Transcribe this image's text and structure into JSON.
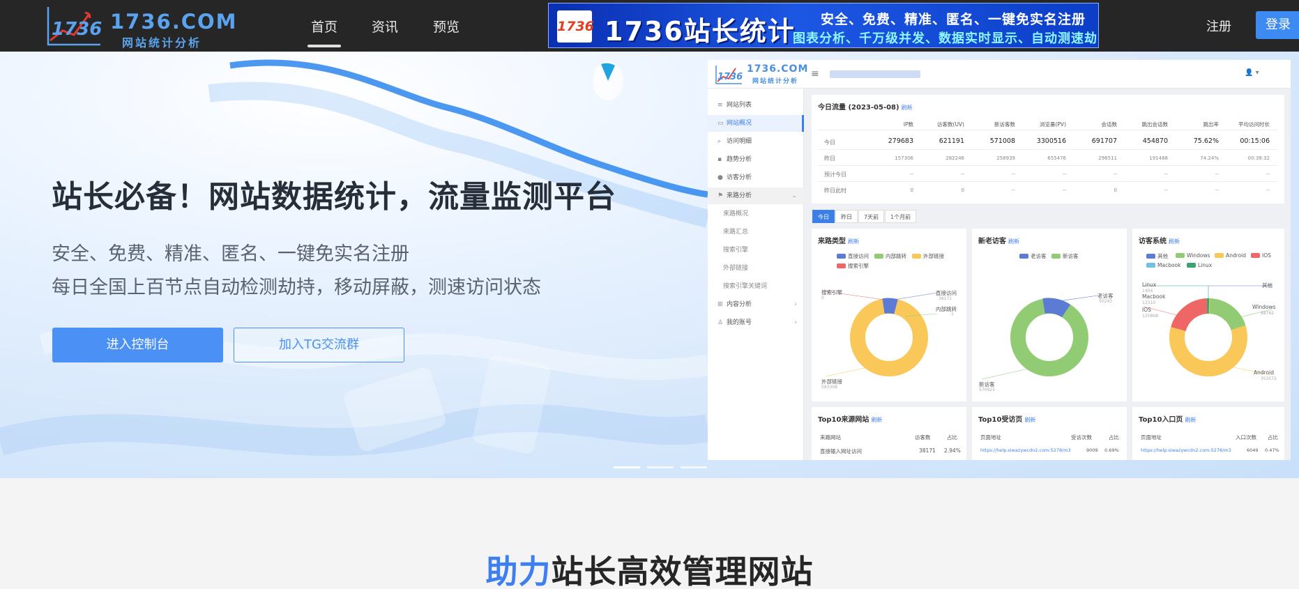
{
  "brand": {
    "name": "1736.COM",
    "subtitle": "网站统计分析",
    "mark_text": "1736"
  },
  "nav": {
    "items": [
      "首页",
      "资讯",
      "预览"
    ],
    "active_index": 0
  },
  "ad_banner": {
    "logo_text": "1736",
    "title": "1736站长统计",
    "line1": "安全、免费、精准、匿名、一键免实名注册",
    "line2": "图表分析、千万级并发、数据实时显示、自动测速劫持检测"
  },
  "auth": {
    "register": "注册",
    "login": "登录"
  },
  "hero": {
    "headline": "站长必备！网站数据统计，流量监测平台",
    "tagline1": "安全、免费、精准、匿名、一键免实名注册",
    "tagline2": "每日全国上百节点自动检测劫持，移动屏蔽，测速访问状态",
    "btn_console": "进入控制台",
    "btn_tg": "加入TG交流群",
    "slide_count": 3,
    "active_slide": 0
  },
  "dashboard": {
    "logo": {
      "mark": "1736",
      "name": "1736.COM",
      "sub": "网站统计分析"
    },
    "menu": [
      {
        "label": "网站列表",
        "icon": "list-icon"
      },
      {
        "label": "网站概况",
        "icon": "monitor-icon",
        "selected": true
      },
      {
        "label": "访问明细",
        "icon": "search-icon"
      },
      {
        "label": "趋势分析",
        "icon": "chart-icon"
      },
      {
        "label": "访客分析",
        "icon": "user-icon"
      },
      {
        "label": "来路分析",
        "icon": "flag-icon",
        "group": true
      },
      {
        "label": "来路概况",
        "sub": true
      },
      {
        "label": "来路汇总",
        "sub": true
      },
      {
        "label": "搜索引擎",
        "sub": true
      },
      {
        "label": "外部链接",
        "sub": true
      },
      {
        "label": "搜索引擎关键词",
        "sub": true
      },
      {
        "label": "内容分析",
        "icon": "grid-icon",
        "group": true
      },
      {
        "label": "我的账号",
        "icon": "person-icon",
        "group": true
      }
    ],
    "traffic": {
      "title": "今日流量 (2023-05-08)",
      "refresh": "刷新",
      "columns": [
        "IP数",
        "访客数(UV)",
        "新访客数",
        "浏览量(PV)",
        "会话数",
        "跳出会话数",
        "跳出率",
        "平均访问时长"
      ],
      "rows": [
        {
          "label": "今日",
          "values": [
            "279683",
            "621191",
            "571008",
            "3300516",
            "691707",
            "454870",
            "75.62%",
            "00:15:06"
          ]
        },
        {
          "label": "昨日",
          "values": [
            "157306",
            "282246",
            "258939",
            "655476",
            "296511",
            "191488",
            "74.24%",
            "00:38:32"
          ]
        },
        {
          "label": "预计今日",
          "values": [
            "--",
            "--",
            "--",
            "--",
            "--",
            "--",
            "--",
            "--"
          ]
        },
        {
          "label": "昨日此时",
          "values": [
            "0",
            "0",
            "--",
            "--",
            "0",
            "--",
            "--",
            "--"
          ]
        }
      ]
    },
    "tabs": [
      "今日",
      "昨日",
      "7天前",
      "1个月前"
    ],
    "active_tab": 0,
    "source_type": {
      "title": "来路类型",
      "refresh": "刷新",
      "legend": [
        {
          "name": "直接访问",
          "color": "#5b7bd5"
        },
        {
          "name": "内部跳转",
          "color": "#91cc75"
        },
        {
          "name": "外部链接",
          "color": "#fac858"
        },
        {
          "name": "搜索引擎",
          "color": "#ee6666"
        }
      ],
      "labels": {
        "direct": "直接访问",
        "internal": "内部跳转",
        "external": "外部链接",
        "search": "搜索引擎"
      },
      "values": {
        "direct": "38171",
        "internal": "1",
        "external": "583308",
        "search": "0"
      }
    },
    "new_old": {
      "title": "新老访客",
      "refresh": "刷新",
      "legend": [
        {
          "name": "老访客",
          "color": "#5b7bd5"
        },
        {
          "name": "新访客",
          "color": "#91cc75"
        }
      ],
      "labels": {
        "old": "老访客",
        "new": "新访客"
      },
      "values": {
        "old": "50243",
        "new": "570925"
      }
    },
    "os": {
      "title": "访客系统",
      "refresh": "刷新",
      "legend": [
        {
          "name": "其他",
          "color": "#5b7bd5"
        },
        {
          "name": "Windows",
          "color": "#91cc75"
        },
        {
          "name": "Android",
          "color": "#fac858"
        },
        {
          "name": "IOS",
          "color": "#ee6666"
        },
        {
          "name": "Macbook",
          "color": "#73c0de"
        },
        {
          "name": "Linux",
          "color": "#3ba272"
        }
      ],
      "labels": {
        "other": "其他",
        "windows": "Windows",
        "android": "Android",
        "ios": "IOS",
        "mac": "Macbook",
        "linux": "Linux"
      },
      "values": {
        "linux": "1404",
        "mac": "13310",
        "ios": "125868",
        "windows": "88762",
        "android": "353572"
      }
    },
    "top_sources": {
      "title": "Top10来源网站",
      "refresh": "刷新",
      "col1": "来路网站",
      "col2": "访客数",
      "col3": "占比",
      "row": [
        "直接输入网址访问",
        "38171",
        "2.94%"
      ]
    },
    "top_pages": {
      "title": "Top10受访页",
      "refresh": "刷新",
      "col1": "页面地址",
      "col2": "受访次数",
      "col3": "占比",
      "row": [
        "https://help.siwazywcdn2.com:5278/m3",
        "9009",
        "0.69%"
      ]
    },
    "top_entry": {
      "title": "Top10入口页",
      "refresh": "刷新",
      "col1": "页面地址",
      "col2": "入口次数",
      "col3": "占比",
      "row": [
        "https://help.siwazywcdn2.com:5278/m3",
        "6049",
        "0.47%"
      ]
    }
  },
  "section": {
    "title_highlight": "助力",
    "title_rest": "站长高效管理网站"
  }
}
